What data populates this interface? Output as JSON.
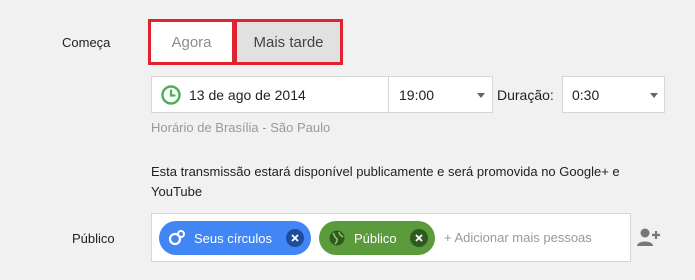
{
  "starts": {
    "label": "Começa",
    "now_label": "Agora",
    "later_label": "Mais tarde"
  },
  "schedule": {
    "date": "13 de ago de 2014",
    "time": "19:00",
    "duration_label": "Duração:",
    "duration": "0:30",
    "timezone": "Horário de Brasília - São Paulo"
  },
  "info_text": "Esta transmissão estará disponível publicamente e será promovida no Google+ e YouTube",
  "audience": {
    "label": "Público",
    "chips": [
      {
        "label": "Seus círculos",
        "color": "#4285f4",
        "icon": "circles-icon"
      },
      {
        "label": "Público",
        "color": "#5b9b3b",
        "icon": "globe-icon"
      }
    ],
    "add_placeholder": "+ Adicionar mais pessoas"
  },
  "colors": {
    "highlight": "#e0242f",
    "background": "#f1f1f1",
    "clock": "#4caf50"
  }
}
